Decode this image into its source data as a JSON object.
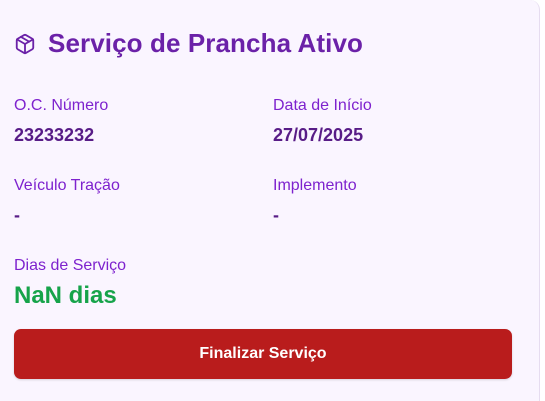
{
  "card": {
    "title": "Serviço de Prancha Ativo",
    "icon": "package-icon",
    "fields": {
      "oc_numero": {
        "label": "O.C. Número",
        "value": "23233232"
      },
      "data_inicio": {
        "label": "Data de Início",
        "value": "27/07/2025"
      },
      "veiculo_tracao": {
        "label": "Veículo Tração",
        "value": "-"
      },
      "implemento": {
        "label": "Implemento",
        "value": "-"
      },
      "dias_servico": {
        "label": "Dias de Serviço",
        "value": "NaN dias"
      }
    },
    "finalize_button_label": "Finalizar Serviço"
  },
  "colors": {
    "card_bg": "#faf5ff",
    "title": "#6b21a8",
    "label": "#7e22ce",
    "value": "#581c87",
    "days_value": "#16a34a",
    "button": "#b91c1c"
  }
}
